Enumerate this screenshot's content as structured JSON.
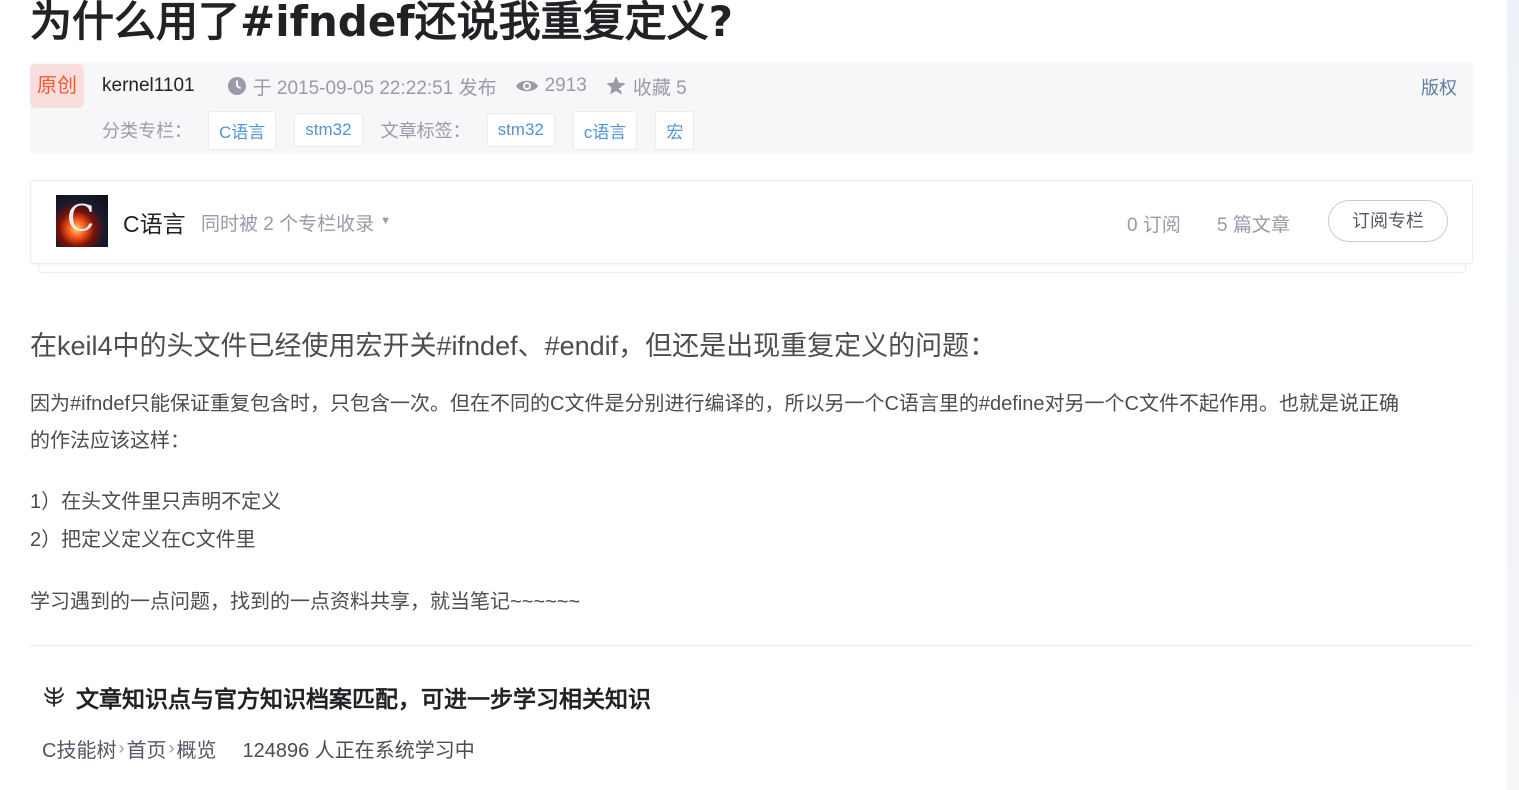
{
  "article": {
    "title": "为什么用了#ifndef还说我重复定义?",
    "badge": "原创",
    "author": "kernel1101",
    "publish_time": "于 2015-09-05 22:22:51 发布",
    "views": "2913",
    "favorites": "收藏 5",
    "copyright": "版权",
    "category_label": "分类专栏：",
    "categories": [
      "C语言",
      "stm32"
    ],
    "tag_label": "文章标签：",
    "tags": [
      "stm32",
      "c语言",
      "宏"
    ]
  },
  "column": {
    "thumb_letter": "C",
    "name": "C语言",
    "included_text": "同时被 2 个专栏收录",
    "subscribers": "0 订阅",
    "articles": "5 篇文章",
    "subscribe_button": "订阅专栏"
  },
  "content": {
    "heading": "在keil4中的头文件已经使用宏开关#ifndef、#endif，但还是出现重复定义的问题：",
    "para1_line1": "因为#ifndef只能保证重复包含时，只包含一次。但在不同的C文件是分别进行编译的，所以另一个C语言里的#define对另一个C文件不起作用。也就是说正确",
    "para1_line2": "的作法应该这样：",
    "item1": "1）在头文件里只声明不定义",
    "item2": "2）把定义定义在C文件里",
    "closing": "学习遇到的一点问题，找到的一点资料共享，就当笔记~~~~~~"
  },
  "knowledge": {
    "title": "文章知识点与官方知识档案匹配，可进一步学习相关知识",
    "path": [
      "C技能树",
      "首页",
      "概览"
    ],
    "learners": "124896 人正在系统学习中"
  },
  "icons": {
    "time": "clock-icon",
    "views": "eye-icon",
    "favorites": "star-icon",
    "knowledge": "knowledge-tree-icon",
    "dropdown": "caret-down-icon"
  },
  "colors": {
    "accent_red": "#fc5531",
    "badge_bg": "#f9dede",
    "tag_blue": "#5094d5",
    "meta_grey": "#999aaa",
    "copyright_blue": "#5e7ea0"
  }
}
